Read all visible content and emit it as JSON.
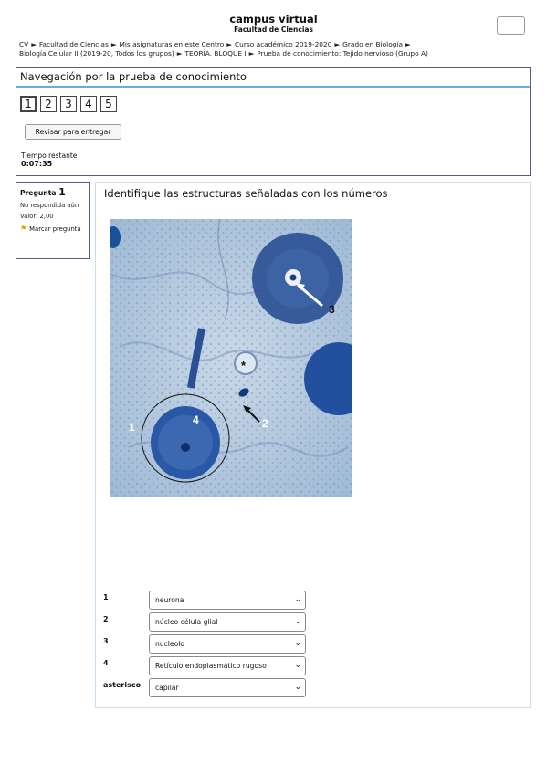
{
  "header": {
    "title": "campus virtual",
    "subtitle": "Facultad de Ciencias"
  },
  "breadcrumb": {
    "items": [
      "CV",
      "Facultad de Ciencias",
      "Mis asignaturas en este Centro",
      "Curso académico 2019-2020",
      "Grado en Biología",
      "Biología Celular II (2019-20, Todos los grupos)",
      "TEORÍA. BLOQUE I",
      "Prueba de conocimiento: Tejido nervioso (Grupo A)"
    ],
    "separator": "►"
  },
  "nav": {
    "title": "Navegación por la prueba de conocimiento",
    "questions": [
      "1",
      "2",
      "3",
      "4",
      "5"
    ],
    "review_button": "Revisar para entregar",
    "time_label": "Tiempo restante",
    "time_value": "0:07:35"
  },
  "question_info": {
    "label": "Pregunta",
    "number": "1",
    "status": "No respondida aún",
    "grade": "Valor: 2,00",
    "flag_label": "Marcar pregunta",
    "icon": "flag-icon"
  },
  "question": {
    "text": "Identifique las estructuras señaladas con los números",
    "figure_labels": [
      "1",
      "2",
      "3",
      "4",
      "*"
    ],
    "answers": [
      {
        "label": "1",
        "value": "neurona"
      },
      {
        "label": "2",
        "value": "núcleo célula glial"
      },
      {
        "label": "3",
        "value": "nucleolo"
      },
      {
        "label": "4",
        "value": "Retículo endoplasmático rugoso"
      },
      {
        "label": "asterisco",
        "value": "capilar"
      }
    ]
  },
  "colors": {
    "panel_border": "#5b5b8a",
    "accent_line": "#6aaed6",
    "stain_dark": "#1a4f9a",
    "stain_light": "#9fb9d4"
  }
}
